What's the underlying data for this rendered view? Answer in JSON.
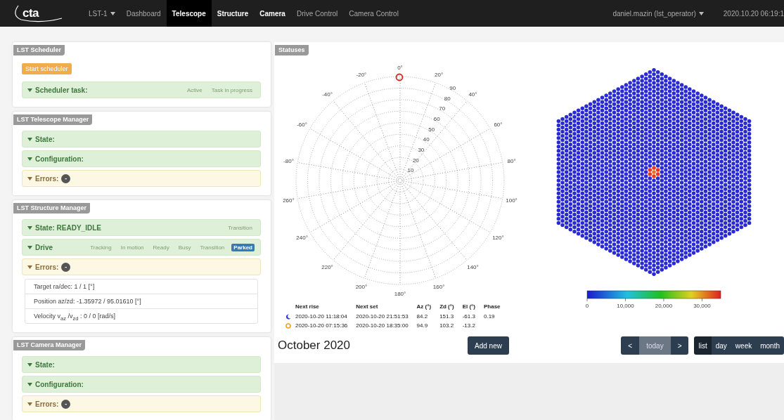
{
  "navbar": {
    "logo": "cta",
    "items": [
      {
        "label": "LST-1",
        "kind": "dropdown",
        "selected": false,
        "highlighted": false
      },
      {
        "label": "Dashboard",
        "kind": "link",
        "selected": false,
        "highlighted": false
      },
      {
        "label": "Telescope",
        "kind": "link",
        "selected": true,
        "highlighted": true
      },
      {
        "label": "Structure",
        "kind": "link",
        "selected": false,
        "highlighted": true
      },
      {
        "label": "Camera",
        "kind": "link",
        "selected": false,
        "highlighted": true
      },
      {
        "label": "Drive Control",
        "kind": "link",
        "selected": false,
        "highlighted": false
      },
      {
        "label": "Camera Control",
        "kind": "link",
        "selected": false,
        "highlighted": false
      }
    ],
    "user": "daniel.mazin (lst_operator)",
    "datetime": "2020.10.20 06:19:1"
  },
  "managers": [
    {
      "title": "LST Scheduler",
      "button": "Start scheduler",
      "sections": [
        {
          "kind": "state",
          "label": "Scheduler task:",
          "flags": [
            {
              "label": "Active",
              "on": false
            },
            {
              "label": "Task in progress",
              "on": false
            }
          ]
        }
      ]
    },
    {
      "title": "LST Telescope Manager",
      "sections": [
        {
          "kind": "state",
          "label": "State:"
        },
        {
          "kind": "state",
          "label": "Configuration:"
        },
        {
          "kind": "errors",
          "label": "Errors:",
          "count": "-"
        }
      ]
    },
    {
      "title": "LST Structure Manager",
      "sections": [
        {
          "kind": "state",
          "label": "State: READY_IDLE",
          "flags": [
            {
              "label": "Transition",
              "on": false
            }
          ]
        },
        {
          "kind": "state",
          "label": "Drive",
          "flags": [
            {
              "label": "Tracking",
              "on": false
            },
            {
              "label": "In motion",
              "on": false
            },
            {
              "label": "Ready",
              "on": false
            },
            {
              "label": "Busy",
              "on": false
            },
            {
              "label": "Transition",
              "on": false
            },
            {
              "label": "Parked",
              "on": true
            }
          ]
        },
        {
          "kind": "errors",
          "label": "Errors:",
          "count": "-"
        }
      ],
      "details": [
        "Target ra/dec: 1 / 1 [°]",
        "Position az/zd: -1.35972 / 95.01610 [°]",
        "Velocity v$_{az}$ /v$_{zd}$ : 0 / 0 [rad/s]"
      ]
    },
    {
      "title": "LST Camera Manager",
      "sections": [
        {
          "kind": "state",
          "label": "State:"
        },
        {
          "kind": "state",
          "label": "Configuration:"
        },
        {
          "kind": "errors",
          "label": "Errors:",
          "count": "-"
        }
      ]
    }
  ],
  "statuses": {
    "title": "Statuses",
    "sky_plot": {
      "azimuth_labels": [
        "0°",
        "20°",
        "40°",
        "60°",
        "80°",
        "100°",
        "120°",
        "140°",
        "160°",
        "180°",
        "200°",
        "220°",
        "240°",
        "260°",
        "-80°",
        "-60°",
        "-40°",
        "-20°"
      ],
      "zenith_labels": [
        "10",
        "20",
        "30",
        "40",
        "50",
        "60",
        "70",
        "80",
        "90"
      ]
    },
    "camera": {
      "colorbar_ticks": [
        "0",
        "10,000",
        "20,000",
        "30,000"
      ]
    },
    "ephemeris": {
      "columns": [
        "Next rise",
        "Next set",
        "Az (°)",
        "Zd (°)",
        "El (°)",
        "Phase"
      ],
      "rows": [
        {
          "kind": "moon",
          "cells": [
            "2020-10-20 11:18:04",
            "2020-10-20 21:51:53",
            "84.2",
            "151.3",
            "-61.3",
            "0.19"
          ]
        },
        {
          "kind": "sun",
          "cells": [
            "2020-10-20 07:15:36",
            "2020-10-20 18:35:00",
            "94.9",
            "103.2",
            "-13.2"
          ]
        }
      ]
    }
  },
  "calendar": {
    "title": "October 2020",
    "add_button": "Add new",
    "nav": [
      {
        "label": "<",
        "disabled": false
      },
      {
        "label": "today",
        "disabled": true
      },
      {
        "label": ">",
        "disabled": false
      }
    ],
    "views": [
      {
        "label": "list",
        "selected": true
      },
      {
        "label": "day",
        "selected": false
      },
      {
        "label": "week",
        "selected": false
      },
      {
        "label": "month",
        "selected": false
      }
    ]
  }
}
